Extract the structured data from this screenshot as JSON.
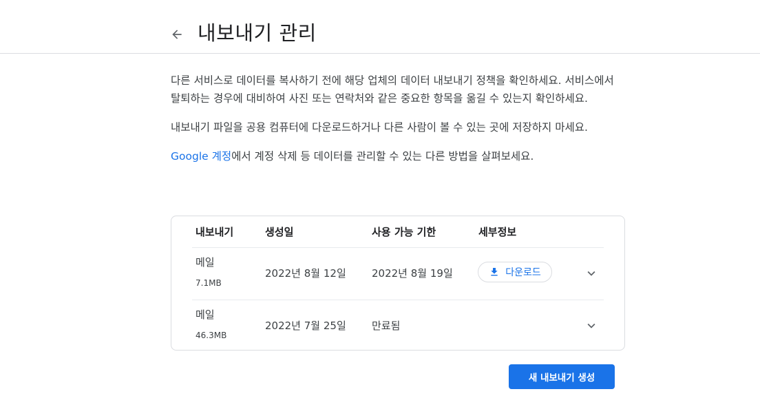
{
  "header": {
    "back_icon": "arrow-back-icon",
    "title": "내보내기 관리"
  },
  "intro": {
    "para1": "다른 서비스로 데이터를 복사하기 전에 해당 업체의 데이터 내보내기 정책을 확인하세요. 서비스에서 탈퇴하는 경우에 대비하여 사진 또는 연락처와 같은 중요한 항목을 옮길 수 있는지 확인하세요.",
    "para2": "내보내기 파일을 공용 컴퓨터에 다운로드하거나 다른 사람이 볼 수 있는 곳에 저장하지 마세요.",
    "para3_link": "Google 계정",
    "para3_rest": "에서 계정 삭제 등 데이터를 관리할 수 있는 다른 방법을 살펴보세요."
  },
  "table": {
    "headers": [
      "내보내기",
      "생성일",
      "사용 가능 기한",
      "세부정보"
    ],
    "rows": [
      {
        "type": "메일",
        "size": "7.1MB",
        "created": "2022년 8월 12일",
        "expires": "2022년 8월 19일",
        "action": "다운로드"
      },
      {
        "type": "메일",
        "size": "46.3MB",
        "created": "2022년 7월 25일",
        "expires": "만료됨"
      }
    ]
  },
  "icons": {
    "download": "download-icon",
    "expand": "chevron-down-icon"
  },
  "actions": {
    "create_label": "새 내보내기 생성"
  },
  "colors": {
    "accent": "#1a73e8",
    "border": "#dadce0"
  }
}
